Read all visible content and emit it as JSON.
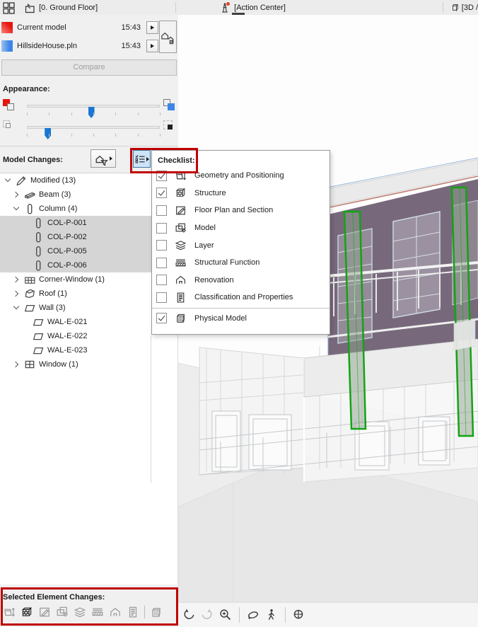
{
  "topbar": {
    "tabs": [
      {
        "label": "[0. Ground Floor]",
        "icon": "floor-plan-icon"
      },
      {
        "label": "[Action Center]",
        "icon": "action-center-icon",
        "notification": true
      },
      {
        "label": "[3D /",
        "icon": "cube-icon"
      }
    ]
  },
  "models": {
    "rows": [
      {
        "name": "Current model",
        "time": "15:43",
        "color": "#e8150f"
      },
      {
        "name": "HillsideHouse.pln",
        "time": "15:43",
        "color": "#3c86e8"
      }
    ],
    "compare_label": "Compare"
  },
  "appearance": {
    "label": "Appearance:",
    "sliders": [
      {
        "percent": 48,
        "left_icon": "model-a-fill-icon",
        "right_icon": "model-b-fill-icon"
      },
      {
        "percent": 15,
        "left_icon": "outline-only-icon",
        "right_icon": "solid-black-icon"
      }
    ]
  },
  "model_changes": {
    "label": "Model Changes:",
    "filter_button_icon": "model-filter-icon",
    "checklist_button_icon": "checklist-icon",
    "tree": [
      {
        "label": "Modified (13)",
        "level": 0,
        "expanded": true,
        "icon": "pencil-icon",
        "selected": false
      },
      {
        "label": "Beam (3)",
        "level": 1,
        "expanded": false,
        "icon": "beam-icon",
        "selected": false
      },
      {
        "label": "Column (4)",
        "level": 1,
        "expanded": true,
        "icon": "column-icon",
        "selected": false
      },
      {
        "label": "COL-P-001",
        "level": 2,
        "expanded": null,
        "icon": "column-icon",
        "selected": true
      },
      {
        "label": "COL-P-002",
        "level": 2,
        "expanded": null,
        "icon": "column-icon",
        "selected": true
      },
      {
        "label": "COL-P-005",
        "level": 2,
        "expanded": null,
        "icon": "column-icon",
        "selected": true
      },
      {
        "label": "COL-P-006",
        "level": 2,
        "expanded": null,
        "icon": "column-icon",
        "selected": true
      },
      {
        "label": "Corner-Window (1)",
        "level": 1,
        "expanded": false,
        "icon": "corner-window-icon",
        "selected": false
      },
      {
        "label": "Roof (1)",
        "level": 1,
        "expanded": false,
        "icon": "roof-icon",
        "selected": false
      },
      {
        "label": "Wall (3)",
        "level": 1,
        "expanded": true,
        "icon": "wall-icon",
        "selected": false
      },
      {
        "label": "WAL-E-021",
        "level": 2,
        "expanded": null,
        "icon": "wall-icon",
        "selected": false
      },
      {
        "label": "WAL-E-022",
        "level": 2,
        "expanded": null,
        "icon": "wall-icon",
        "selected": false
      },
      {
        "label": "WAL-E-023",
        "level": 2,
        "expanded": null,
        "icon": "wall-icon",
        "selected": false
      },
      {
        "label": "Window (1)",
        "level": 1,
        "expanded": false,
        "icon": "window-icon",
        "selected": false
      }
    ]
  },
  "checklist": {
    "title": "Checklist:",
    "items": [
      {
        "label": "Geometry and Positioning",
        "checked": true,
        "icon": "geometry-icon"
      },
      {
        "label": "Structure",
        "checked": true,
        "icon": "structure-icon"
      },
      {
        "label": "Floor Plan and Section",
        "checked": false,
        "icon": "floor-plan-section-icon"
      },
      {
        "label": "Model",
        "checked": false,
        "icon": "model-icon"
      },
      {
        "label": "Layer",
        "checked": false,
        "icon": "layer-icon"
      },
      {
        "label": "Structural Function",
        "checked": false,
        "icon": "structural-function-icon"
      },
      {
        "label": "Renovation",
        "checked": false,
        "icon": "renovation-icon"
      },
      {
        "label": "Classification and Properties",
        "checked": false,
        "icon": "classification-icon"
      }
    ],
    "footer": {
      "label": "Physical Model",
      "checked": true,
      "icon": "physical-model-icon"
    }
  },
  "selected_changes": {
    "label": "Selected Element Changes:",
    "icons": [
      {
        "name": "geometry",
        "active": false
      },
      {
        "name": "structure",
        "active": true
      },
      {
        "name": "floor-plan-section",
        "active": false
      },
      {
        "name": "model",
        "active": false
      },
      {
        "name": "layer",
        "active": false
      },
      {
        "name": "structural-function",
        "active": false
      },
      {
        "name": "renovation",
        "active": false
      },
      {
        "name": "classification",
        "active": false
      },
      {
        "name": "physical-model",
        "active": false
      }
    ]
  },
  "viewport_toolbar": {
    "icons": [
      "undo",
      "redo",
      "zoom-in",
      "orbit",
      "walk",
      "fit-in-window"
    ]
  },
  "colors": {
    "annotation_red": "#bf0000",
    "highlight_green": "#16a816",
    "wall_purple": "#77697b",
    "model_a_red": "#e8150f",
    "model_b_blue": "#3c86e8",
    "accent_blue": "#1976d2",
    "checklist_button_bg": "#cde3f6",
    "selection_gray": "#d5d5d5"
  }
}
